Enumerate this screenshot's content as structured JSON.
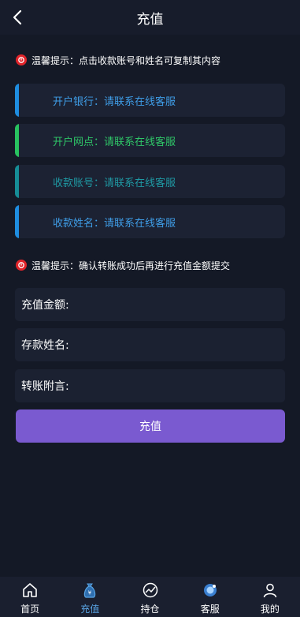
{
  "header": {
    "title": "充值"
  },
  "tips": {
    "top": "温馨提示：点击收款账号和姓名可复制其内容",
    "middle": "温馨提示：确认转账成功后再进行充值金额提交"
  },
  "info_cards": [
    {
      "label": "开户银行：",
      "value": "请联系在线客服",
      "color": "#3f9ee8",
      "bar_color": "#1e8de0"
    },
    {
      "label": "开户网点：",
      "value": "请联系在线客服",
      "color": "#2fc768",
      "bar_color": "#28c25f"
    },
    {
      "label": "收款账号：",
      "value": "请联系在线客服",
      "color": "#1f9aa5",
      "bar_color": "#168d96"
    },
    {
      "label": "收款姓名：",
      "value": "请联系在线客服",
      "color": "#3f9ee8",
      "bar_color": "#1e8de0"
    }
  ],
  "form": {
    "amount_label": "充值金额:",
    "name_label": "存款姓名:",
    "note_label": "转账附言:",
    "amount_value": "",
    "name_value": "",
    "note_value": ""
  },
  "submit_label": "充值",
  "tabs": [
    {
      "label": "首页",
      "icon": "home-icon",
      "active": false
    },
    {
      "label": "充值",
      "icon": "moneybag-icon",
      "active": true
    },
    {
      "label": "持仓",
      "icon": "chart-icon",
      "active": false
    },
    {
      "label": "客服",
      "icon": "support-icon",
      "active": false
    },
    {
      "label": "我的",
      "icon": "user-icon",
      "active": false
    }
  ],
  "colors": {
    "background": "#141926",
    "accent": "#7a5ad0",
    "active_tab": "#5aa6e6"
  }
}
